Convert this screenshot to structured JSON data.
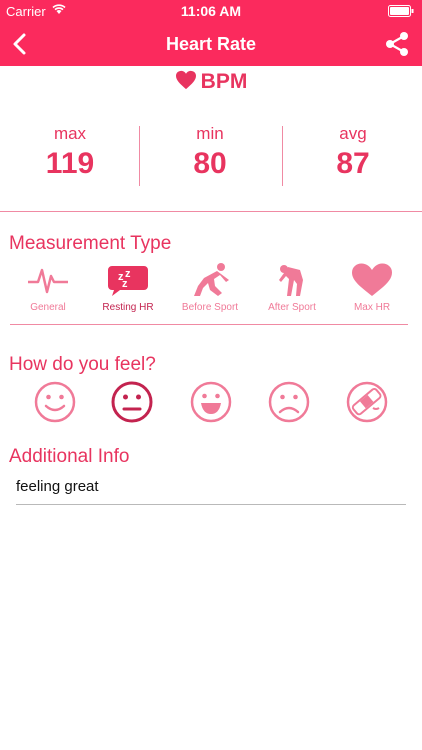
{
  "status_bar": {
    "carrier": "Carrier",
    "time": "11:06 AM"
  },
  "nav": {
    "title": "Heart Rate",
    "back_icon": "chevron-left-icon",
    "share_icon": "share-icon"
  },
  "bpm": {
    "label": "BPM",
    "icon": "heart-icon"
  },
  "stats": [
    {
      "label": "max",
      "value": "119"
    },
    {
      "label": "min",
      "value": "80"
    },
    {
      "label": "avg",
      "value": "87"
    }
  ],
  "measurement_type": {
    "title": "Measurement Type",
    "items": [
      {
        "label": "General",
        "icon": "heartbeat-line-icon",
        "selected": false
      },
      {
        "label": "Resting HR",
        "icon": "sleep-zzz-icon",
        "selected": true
      },
      {
        "label": "Before Sport",
        "icon": "sprinter-icon",
        "selected": false
      },
      {
        "label": "After Sport",
        "icon": "tired-runner-icon",
        "selected": false
      },
      {
        "label": "Max HR",
        "icon": "heart-icon",
        "selected": false
      }
    ]
  },
  "feel": {
    "title": "How do you feel?",
    "moods": [
      {
        "icon": "smile-face-icon",
        "selected": false
      },
      {
        "icon": "neutral-face-icon",
        "selected": true
      },
      {
        "icon": "happy-face-icon",
        "selected": false
      },
      {
        "icon": "sad-face-icon",
        "selected": false
      },
      {
        "icon": "sick-face-icon",
        "selected": false
      }
    ]
  },
  "additional_info": {
    "title": "Additional Info",
    "value": "feeling great"
  },
  "colors": {
    "accent": "#fb2a5d",
    "text_pink": "#e8345f",
    "icon_pink": "#f07a98",
    "selected_pink": "#c3234f"
  }
}
